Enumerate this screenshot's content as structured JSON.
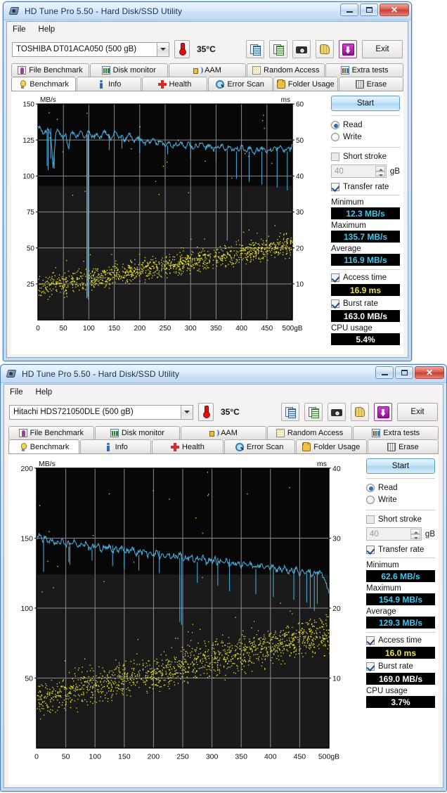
{
  "windows": [
    {
      "title": "HD Tune Pro 5.50 - Hard Disk/SSD Utility",
      "menu": [
        "File",
        "Help"
      ],
      "toolbar": {
        "drive": "TOSHIBA DT01ACA050 (500 gB)",
        "temperature": "35°C",
        "exit_label": "Exit",
        "icons": [
          "copy-icon",
          "copy-excel-icon",
          "camera-icon",
          "glove-icon",
          "download-icon"
        ]
      },
      "tabs_row1": [
        "File Benchmark",
        "Disk monitor",
        "AAM",
        "Random Access",
        "Extra tests"
      ],
      "tabs_row2": [
        "Benchmark",
        "Info",
        "Health",
        "Error Scan",
        "Folder Usage",
        "Erase"
      ],
      "active_tab": "Benchmark",
      "panel": {
        "start_label": "Start",
        "read_label": "Read",
        "write_label": "Write",
        "short_stroke_label": "Short stroke",
        "short_stroke_value": "40",
        "short_stroke_unit": "gB",
        "transfer_rate_label": "Transfer rate",
        "minimum_label": "Minimum",
        "minimum_value": "12.3 MB/s",
        "maximum_label": "Maximum",
        "maximum_value": "135.7 MB/s",
        "average_label": "Average",
        "average_value": "116.9 MB/s",
        "access_time_label": "Access time",
        "access_time_value": "16.9 ms",
        "burst_rate_label": "Burst rate",
        "burst_rate_value": "163.0 MB/s",
        "cpu_usage_label": "CPU usage",
        "cpu_usage_value": "5.4%"
      }
    },
    {
      "title": "HD Tune Pro 5.50 - Hard Disk/SSD Utility",
      "menu": [
        "File",
        "Help"
      ],
      "toolbar": {
        "drive": "Hitachi HDS721050DLE (500 gB)",
        "temperature": "35°C",
        "exit_label": "Exit",
        "icons": [
          "copy-icon",
          "copy-excel-icon",
          "camera-icon",
          "glove-icon",
          "download-icon"
        ]
      },
      "tabs_row1": [
        "File Benchmark",
        "Disk monitor",
        "AAM",
        "Random Access",
        "Extra tests"
      ],
      "tabs_row2": [
        "Benchmark",
        "Info",
        "Health",
        "Error Scan",
        "Folder Usage",
        "Erase"
      ],
      "active_tab": "Benchmark",
      "panel": {
        "start_label": "Start",
        "read_label": "Read",
        "write_label": "Write",
        "short_stroke_label": "Short stroke",
        "short_stroke_value": "40",
        "short_stroke_unit": "gB",
        "transfer_rate_label": "Transfer rate",
        "minimum_label": "Minimum",
        "minimum_value": "62.6 MB/s",
        "maximum_label": "Maximum",
        "maximum_value": "154.9 MB/s",
        "average_label": "Average",
        "average_value": "129.3 MB/s",
        "access_time_label": "Access time",
        "access_time_value": "16.0 ms",
        "burst_rate_label": "Burst rate",
        "burst_rate_value": "169.0 MB/s",
        "cpu_usage_label": "CPU usage",
        "cpu_usage_value": "3.7%"
      }
    }
  ],
  "chart_data": [
    {
      "type": "line",
      "title": "",
      "ylabel": "MB/s",
      "y2label": "ms",
      "xlabel": "500gB",
      "xlim": [
        0,
        500
      ],
      "ylim": [
        0,
        150
      ],
      "y2lim": [
        0,
        60
      ],
      "xticks": [
        0,
        50,
        100,
        150,
        200,
        250,
        300,
        350,
        400,
        450,
        500
      ],
      "xticklabels": [
        "0",
        "50",
        "100",
        "150",
        "200",
        "250",
        "300",
        "350",
        "400",
        "450",
        "500gB"
      ],
      "yticks": [
        25,
        50,
        75,
        100,
        125,
        150
      ],
      "y2ticks": [
        10,
        20,
        30,
        40,
        50,
        60
      ],
      "grid": true,
      "legend": null,
      "series": [
        {
          "name": "transfer rate",
          "color": "#4ab4e6",
          "axis": "left",
          "x": [
            0,
            5,
            10,
            15,
            20,
            25,
            30,
            35,
            40,
            45,
            50,
            55,
            60,
            65,
            70,
            75,
            80,
            85,
            90,
            95,
            100,
            105,
            110,
            115,
            120,
            125,
            130,
            135,
            140,
            145,
            150,
            155,
            160,
            165,
            170,
            175,
            180,
            185,
            190,
            195,
            200,
            205,
            210,
            215,
            220,
            225,
            230,
            235,
            240,
            245,
            250,
            255,
            260,
            265,
            270,
            275,
            280,
            285,
            290,
            295,
            300,
            305,
            310,
            315,
            320,
            325,
            330,
            335,
            340,
            345,
            350,
            355,
            360,
            365,
            370,
            375,
            380,
            385,
            390,
            395,
            400,
            405,
            410,
            415,
            420,
            425,
            430,
            435,
            440,
            445,
            450,
            455,
            460,
            465,
            470,
            475,
            480,
            485,
            490,
            495,
            500
          ],
          "y": [
            134,
            133,
            130,
            131,
            133,
            129,
            105,
            131,
            132,
            128,
            126,
            129,
            118,
            131,
            130,
            127,
            129,
            132,
            126,
            129,
            131,
            128,
            127,
            130,
            126,
            128,
            131,
            129,
            127,
            125,
            131,
            130,
            126,
            128,
            124,
            127,
            130,
            126,
            124,
            127,
            126,
            124,
            122,
            125,
            123,
            126,
            124,
            122,
            125,
            123,
            121,
            124,
            122,
            120,
            123,
            121,
            124,
            122,
            120,
            123,
            121,
            119,
            122,
            120,
            123,
            121,
            119,
            122,
            120,
            118,
            121,
            119,
            122,
            120,
            118,
            121,
            119,
            117,
            120,
            118,
            121,
            119,
            117,
            120,
            118,
            116,
            119,
            117,
            120,
            118,
            116,
            119,
            117,
            120,
            118,
            121,
            119,
            117,
            120,
            118,
            121
          ]
        },
        {
          "name": "transfer rate drops",
          "color": "#4ab4e6",
          "axis": "left",
          "drops": [
            [
              18,
              107
            ],
            [
              20,
              104
            ],
            [
              25,
              112
            ],
            [
              32,
              117
            ],
            [
              96,
              15
            ],
            [
              98,
              16
            ],
            [
              99,
              14
            ],
            [
              140,
              118
            ],
            [
              165,
              119
            ],
            [
              200,
              116
            ],
            [
              255,
              115
            ],
            [
              300,
              112
            ],
            [
              350,
              110
            ],
            [
              372,
              55
            ],
            [
              390,
              98
            ],
            [
              415,
              96
            ],
            [
              440,
              94
            ],
            [
              470,
              92
            ],
            [
              490,
              90
            ]
          ]
        },
        {
          "name": "access time",
          "color": "#f2e827",
          "axis": "right",
          "style": "scatter",
          "note": "yellow scatter of access-time samples rising from ~10ms at 0gB to ~22ms near 500gB"
        }
      ]
    },
    {
      "type": "line",
      "title": "",
      "ylabel": "MB/s",
      "y2label": "ms",
      "xlabel": "500gB",
      "xlim": [
        0,
        500
      ],
      "ylim": [
        0,
        200
      ],
      "y2lim": [
        0,
        40
      ],
      "xticks": [
        0,
        50,
        100,
        150,
        200,
        250,
        300,
        350,
        400,
        450,
        500
      ],
      "xticklabels": [
        "0",
        "50",
        "100",
        "150",
        "200",
        "250",
        "300",
        "350",
        "400",
        "450",
        "500gB"
      ],
      "yticks": [
        50,
        100,
        150,
        200
      ],
      "y2ticks": [
        10,
        20,
        30,
        40
      ],
      "grid": true,
      "legend": null,
      "series": [
        {
          "name": "transfer rate",
          "color": "#4ab4e6",
          "axis": "left",
          "x": [
            0,
            5,
            10,
            15,
            20,
            25,
            30,
            35,
            40,
            45,
            50,
            55,
            60,
            65,
            70,
            75,
            80,
            85,
            90,
            95,
            100,
            105,
            110,
            115,
            120,
            125,
            130,
            135,
            140,
            145,
            150,
            155,
            160,
            165,
            170,
            175,
            180,
            185,
            190,
            195,
            200,
            205,
            210,
            215,
            220,
            225,
            230,
            235,
            240,
            245,
            250,
            255,
            260,
            265,
            270,
            275,
            280,
            285,
            290,
            295,
            300,
            305,
            310,
            315,
            320,
            325,
            330,
            335,
            340,
            345,
            350,
            355,
            360,
            365,
            370,
            375,
            380,
            385,
            390,
            395,
            400,
            405,
            410,
            415,
            420,
            425,
            430,
            435,
            440,
            445,
            450,
            455,
            460,
            465,
            470,
            475,
            480,
            485,
            490,
            495,
            500
          ],
          "y": [
            150,
            153,
            148,
            151,
            147,
            150,
            145,
            148,
            146,
            149,
            144,
            147,
            145,
            148,
            143,
            146,
            144,
            147,
            142,
            145,
            143,
            146,
            141,
            144,
            142,
            145,
            140,
            143,
            141,
            144,
            139,
            142,
            140,
            143,
            138,
            141,
            139,
            142,
            137,
            140,
            138,
            141,
            136,
            139,
            137,
            140,
            135,
            138,
            136,
            139,
            134,
            137,
            135,
            138,
            133,
            136,
            134,
            137,
            132,
            135,
            133,
            136,
            131,
            134,
            132,
            135,
            130,
            133,
            131,
            134,
            129,
            132,
            130,
            133,
            128,
            131,
            129,
            132,
            127,
            130,
            128,
            131,
            126,
            129,
            127,
            130,
            125,
            128,
            126,
            129,
            124,
            127,
            125,
            128,
            123,
            126,
            124,
            127,
            122,
            118,
            112
          ]
        },
        {
          "name": "transfer rate drops",
          "color": "#4ab4e6",
          "axis": "left",
          "drops": [
            [
              12,
              126
            ],
            [
              55,
              133
            ],
            [
              57,
              131
            ],
            [
              95,
              134
            ],
            [
              130,
              130
            ],
            [
              150,
              128
            ],
            [
              175,
              127
            ],
            [
              210,
              125
            ],
            [
              245,
              90
            ],
            [
              248,
              88
            ],
            [
              275,
              118
            ],
            [
              310,
              116
            ],
            [
              330,
              112
            ],
            [
              375,
              110
            ],
            [
              405,
              108
            ],
            [
              440,
              106
            ],
            [
              462,
              104
            ],
            [
              468,
              100
            ],
            [
              475,
              98
            ],
            [
              480,
              103
            ]
          ]
        },
        {
          "name": "access time",
          "color": "#f2e827",
          "axis": "right",
          "style": "scatter",
          "note": "yellow scatter of access-time samples rising from ~8ms at 0gB to ~17ms near 500gB"
        }
      ]
    }
  ]
}
